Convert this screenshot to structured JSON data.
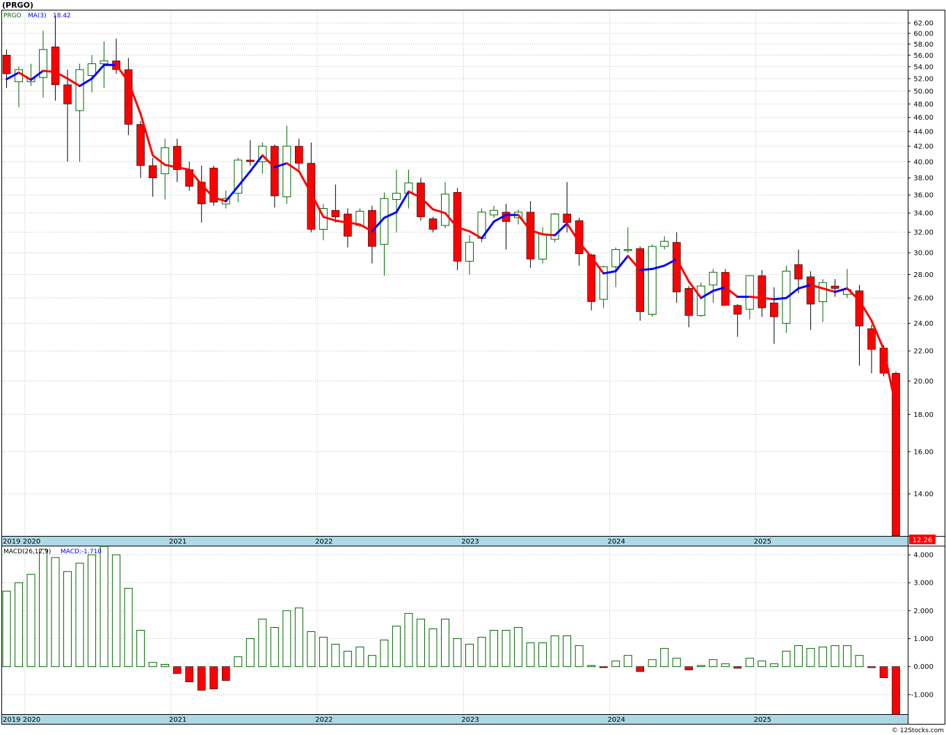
{
  "header": {
    "title": "(PRGO)"
  },
  "price_panel": {
    "symbol_label": "PRGO",
    "ma_label": "MA(3)",
    "ma_value": "18.42",
    "last_price_badge": "12.26",
    "y_ticks": [
      "62.00",
      "60.00",
      "58.00",
      "56.00",
      "54.00",
      "52.00",
      "50.00",
      "48.00",
      "46.00",
      "44.00",
      "42.00",
      "40.00",
      "38.00",
      "36.00",
      "34.00",
      "32.00",
      "30.00",
      "28.00",
      "26.00",
      "24.00",
      "22.00",
      "20.00",
      "18.00",
      "16.00",
      "14.00"
    ],
    "x_ticks": [
      "2019",
      "2020",
      "2021",
      "2022",
      "2023",
      "2024",
      "2025"
    ]
  },
  "macd_panel": {
    "label": "MACD(26,12,9)",
    "value_label": "MACD:-1.710",
    "y_ticks": [
      "4.000",
      "3.000",
      "2.000",
      "1.000",
      "0.000",
      "-1.000"
    ],
    "x_ticks": [
      "2019",
      "2020",
      "2021",
      "2022",
      "2023",
      "2024",
      "2025"
    ]
  },
  "footer": {
    "credit": "© 12Stocks.com"
  },
  "colors": {
    "up_candle": "#006400",
    "down_candle": "#ff0000",
    "ma_up": "#0000ff",
    "ma_down": "#ff0000",
    "axis_band": "#add8e6",
    "grid": "#bbbbbb"
  },
  "chart_data": [
    {
      "type": "candlestick",
      "period": "monthly",
      "ylim": [
        12.26,
        64.5
      ],
      "scale": "log",
      "grid": true,
      "series": [
        {
          "name": "PRGO",
          "ohlc": [
            {
              "o": 56.0,
              "h": 57.0,
              "l": 50.5,
              "c": 52.8
            },
            {
              "o": 51.5,
              "h": 54.0,
              "l": 47.5,
              "c": 53.5
            },
            {
              "o": 51.5,
              "h": 54.5,
              "l": 50.8,
              "c": 52.0
            },
            {
              "o": 52.2,
              "h": 60.5,
              "l": 49.0,
              "c": 57.0
            },
            {
              "o": 57.5,
              "h": 63.5,
              "l": 48.5,
              "c": 51.0
            },
            {
              "o": 51.0,
              "h": 53.5,
              "l": 40.0,
              "c": 48.0
            },
            {
              "o": 47.0,
              "h": 54.5,
              "l": 40.0,
              "c": 53.5
            },
            {
              "o": 52.5,
              "h": 56.0,
              "l": 49.8,
              "c": 54.5
            },
            {
              "o": 54.5,
              "h": 58.5,
              "l": 50.5,
              "c": 55.0
            },
            {
              "o": 55.0,
              "h": 59.0,
              "l": 52.8,
              "c": 53.5
            },
            {
              "o": 53.5,
              "h": 55.5,
              "l": 43.5,
              "c": 45.0
            },
            {
              "o": 45.0,
              "h": 45.5,
              "l": 38.0,
              "c": 39.5
            },
            {
              "o": 39.5,
              "h": 40.5,
              "l": 35.8,
              "c": 38.0
            },
            {
              "o": 38.5,
              "h": 43.0,
              "l": 35.5,
              "c": 41.8
            },
            {
              "o": 42.0,
              "h": 43.0,
              "l": 37.5,
              "c": 39.0
            },
            {
              "o": 39.0,
              "h": 40.0,
              "l": 36.5,
              "c": 37.0
            },
            {
              "o": 37.5,
              "h": 39.5,
              "l": 33.0,
              "c": 35.0
            },
            {
              "o": 39.2,
              "h": 39.5,
              "l": 34.8,
              "c": 35.2
            },
            {
              "o": 35.0,
              "h": 36.5,
              "l": 34.5,
              "c": 35.6
            },
            {
              "o": 36.2,
              "h": 40.5,
              "l": 35.2,
              "c": 40.2
            },
            {
              "o": 40.2,
              "h": 42.8,
              "l": 39.5,
              "c": 40.0
            },
            {
              "o": 40.0,
              "h": 42.5,
              "l": 38.5,
              "c": 42.0
            },
            {
              "o": 42.0,
              "h": 42.2,
              "l": 34.6,
              "c": 35.9
            },
            {
              "o": 35.8,
              "h": 44.8,
              "l": 35.0,
              "c": 42.0
            },
            {
              "o": 42.0,
              "h": 43.0,
              "l": 39.0,
              "c": 39.8
            },
            {
              "o": 39.8,
              "h": 42.5,
              "l": 32.0,
              "c": 32.3
            },
            {
              "o": 32.3,
              "h": 35.0,
              "l": 31.2,
              "c": 34.5
            },
            {
              "o": 34.3,
              "h": 37.2,
              "l": 33.0,
              "c": 33.6
            },
            {
              "o": 33.9,
              "h": 34.5,
              "l": 30.5,
              "c": 31.6
            },
            {
              "o": 32.7,
              "h": 34.5,
              "l": 32.5,
              "c": 34.2
            },
            {
              "o": 34.3,
              "h": 34.8,
              "l": 29.0,
              "c": 30.6
            },
            {
              "o": 30.8,
              "h": 36.3,
              "l": 27.9,
              "c": 35.6
            },
            {
              "o": 35.5,
              "h": 39.0,
              "l": 32.0,
              "c": 36.2
            },
            {
              "o": 36.2,
              "h": 39.0,
              "l": 34.5,
              "c": 37.4
            },
            {
              "o": 37.4,
              "h": 38.0,
              "l": 33.2,
              "c": 33.6
            },
            {
              "o": 33.4,
              "h": 33.6,
              "l": 32.0,
              "c": 32.3
            },
            {
              "o": 32.7,
              "h": 37.5,
              "l": 32.4,
              "c": 36.1
            },
            {
              "o": 36.3,
              "h": 36.8,
              "l": 28.4,
              "c": 29.2
            },
            {
              "o": 29.2,
              "h": 31.7,
              "l": 28.0,
              "c": 31.0
            },
            {
              "o": 31.4,
              "h": 34.5,
              "l": 31.0,
              "c": 34.1
            },
            {
              "o": 33.8,
              "h": 34.8,
              "l": 33.5,
              "c": 34.3
            },
            {
              "o": 34.1,
              "h": 35.0,
              "l": 30.3,
              "c": 33.1
            },
            {
              "o": 33.5,
              "h": 34.4,
              "l": 32.8,
              "c": 34.1
            },
            {
              "o": 34.1,
              "h": 35.3,
              "l": 28.6,
              "c": 29.4
            },
            {
              "o": 29.4,
              "h": 32.5,
              "l": 29.0,
              "c": 31.8
            },
            {
              "o": 31.3,
              "h": 34.0,
              "l": 31.0,
              "c": 33.9
            },
            {
              "o": 33.9,
              "h": 37.5,
              "l": 32.0,
              "c": 33.0
            },
            {
              "o": 33.2,
              "h": 33.5,
              "l": 28.8,
              "c": 29.9
            },
            {
              "o": 29.8,
              "h": 29.9,
              "l": 25.0,
              "c": 25.7
            },
            {
              "o": 25.9,
              "h": 28.8,
              "l": 25.2,
              "c": 28.7
            },
            {
              "o": 28.7,
              "h": 30.5,
              "l": 26.9,
              "c": 30.3
            },
            {
              "o": 30.2,
              "h": 32.5,
              "l": 30.0,
              "c": 30.3
            },
            {
              "o": 30.4,
              "h": 30.6,
              "l": 24.2,
              "c": 24.9
            },
            {
              "o": 24.7,
              "h": 30.8,
              "l": 24.5,
              "c": 30.6
            },
            {
              "o": 30.6,
              "h": 31.6,
              "l": 30.3,
              "c": 31.1
            },
            {
              "o": 31.0,
              "h": 32.0,
              "l": 25.6,
              "c": 26.5
            },
            {
              "o": 26.8,
              "h": 27.0,
              "l": 23.7,
              "c": 24.6
            },
            {
              "o": 24.6,
              "h": 27.3,
              "l": 24.5,
              "c": 27.0
            },
            {
              "o": 27.1,
              "h": 28.5,
              "l": 25.6,
              "c": 28.2
            },
            {
              "o": 28.2,
              "h": 28.5,
              "l": 25.8,
              "c": 25.4
            },
            {
              "o": 25.4,
              "h": 25.5,
              "l": 23.0,
              "c": 24.7
            },
            {
              "o": 25.1,
              "h": 26.7,
              "l": 24.3,
              "c": 27.9
            },
            {
              "o": 27.9,
              "h": 28.4,
              "l": 24.5,
              "c": 25.2
            },
            {
              "o": 25.6,
              "h": 26.9,
              "l": 22.5,
              "c": 24.5
            },
            {
              "o": 24.0,
              "h": 28.8,
              "l": 23.3,
              "c": 28.3
            },
            {
              "o": 28.9,
              "h": 30.3,
              "l": 26.4,
              "c": 27.6
            },
            {
              "o": 27.8,
              "h": 28.3,
              "l": 23.5,
              "c": 25.5
            },
            {
              "o": 25.7,
              "h": 27.6,
              "l": 24.1,
              "c": 27.3
            },
            {
              "o": 27.0,
              "h": 27.6,
              "l": 26.1,
              "c": 26.8
            },
            {
              "o": 26.3,
              "h": 28.5,
              "l": 26.0,
              "c": 26.7
            },
            {
              "o": 26.6,
              "h": 27.1,
              "l": 21.0,
              "c": 23.8
            },
            {
              "o": 23.6,
              "h": 23.9,
              "l": 20.5,
              "c": 22.1
            },
            {
              "o": 22.2,
              "h": 22.4,
              "l": 20.3,
              "c": 20.5
            },
            {
              "o": 20.5,
              "h": 20.6,
              "l": 12.26,
              "c": 12.26
            }
          ]
        },
        {
          "name": "MA(3)",
          "values": [
            51.9,
            53.0,
            51.8,
            53.3,
            53.1,
            52.0,
            50.8,
            52.0,
            54.3,
            54.3,
            51.5,
            46.5,
            40.8,
            39.6,
            39.3,
            39.0,
            37.2,
            35.7,
            35.3,
            37.0,
            38.8,
            40.8,
            39.3,
            39.8,
            38.8,
            36.2,
            33.6,
            33.2,
            33.0,
            32.8,
            32.1,
            33.5,
            34.1,
            36.4,
            35.7,
            34.4,
            34.0,
            32.5,
            32.1,
            31.4,
            33.1,
            33.8,
            33.8,
            32.2,
            31.8,
            31.7,
            32.9,
            31.0,
            29.6,
            28.1,
            28.3,
            29.7,
            28.4,
            28.5,
            28.8,
            29.4,
            27.4,
            26.0,
            26.6,
            26.9,
            26.1,
            26.1,
            26.0,
            25.9,
            26.0,
            26.8,
            27.1,
            26.8,
            26.5,
            26.8,
            25.8,
            24.2,
            22.1,
            18.42
          ]
        }
      ]
    },
    {
      "type": "bar",
      "title": "MACD(26,12,9)",
      "ylim": [
        -1.7,
        4.3
      ],
      "series": [
        {
          "name": "MACD",
          "values": [
            2.7,
            3.0,
            3.3,
            4.2,
            3.9,
            3.4,
            3.7,
            4.0,
            4.3,
            4.0,
            2.8,
            1.3,
            0.15,
            0.08,
            -0.25,
            -0.55,
            -0.85,
            -0.8,
            -0.5,
            0.35,
            1.0,
            1.7,
            1.4,
            2.0,
            2.1,
            1.25,
            1.05,
            0.8,
            0.55,
            0.7,
            0.4,
            0.95,
            1.45,
            1.9,
            1.7,
            1.35,
            1.7,
            1.0,
            0.8,
            1.05,
            1.3,
            1.3,
            1.4,
            0.85,
            0.85,
            1.1,
            1.1,
            0.75,
            0.04,
            -0.04,
            0.2,
            0.4,
            -0.18,
            0.25,
            0.65,
            0.3,
            -0.12,
            0.04,
            0.25,
            0.1,
            -0.06,
            0.3,
            0.2,
            0.1,
            0.55,
            0.75,
            0.65,
            0.7,
            0.75,
            0.75,
            0.4,
            -0.04,
            -0.4,
            -1.71
          ]
        }
      ]
    }
  ]
}
